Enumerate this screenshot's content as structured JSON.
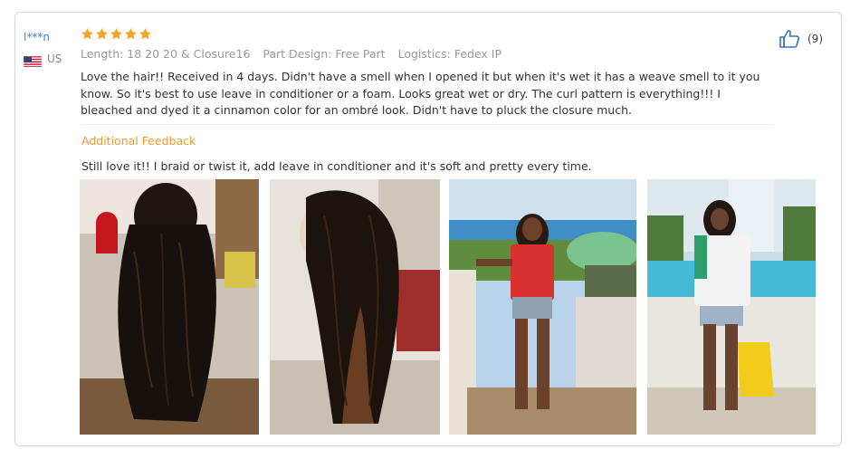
{
  "reviewer": {
    "name": "l***n",
    "country": "US",
    "flag_icon": "us-flag-icon"
  },
  "rating": {
    "stars": 5,
    "max": 5,
    "star_color": "#f5a623"
  },
  "meta": {
    "length": "Length: 18 20 20 & Closure16",
    "part_design": "Part Design: Free Part",
    "logistics": "Logistics: Fedex IP"
  },
  "review_text": "Love the hair!! Received in 4 days. Didn't have a smell when I opened it but when it's wet it has a weave smell to it you know. So it's best to use leave in conditioner or a foam. Looks great wet or dry. The curl pattern is everything!!! I bleached and dyed it a cinnamon color for an ombré look. Didn't have to pluck the closure much.",
  "additional_feedback": {
    "title": "Additional Feedback",
    "text": "Still love it!! I braid or twist it, add leave in conditioner and it's soft and pretty every time."
  },
  "helpful": {
    "icon": "thumbs-up-icon",
    "count_label": "(9)"
  },
  "photos": [
    {
      "name": "photo-wig-back-view"
    },
    {
      "name": "photo-wig-side-view"
    },
    {
      "name": "photo-woman-red-top-balcony"
    },
    {
      "name": "photo-woman-white-shirt-fountain"
    }
  ]
}
